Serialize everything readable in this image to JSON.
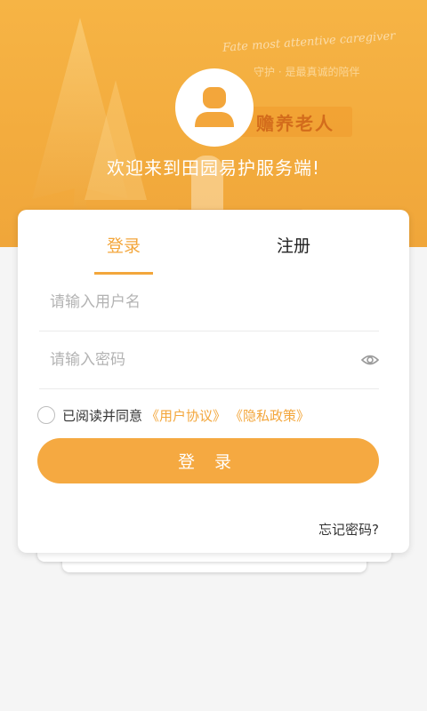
{
  "hero": {
    "deco_script": "Fate most attentive caregiver",
    "deco_line": "守护 · 是最真诚的陪伴",
    "deco_banner": "赡养老人",
    "welcome": "欢迎来到田园易护服务端!"
  },
  "tabs": [
    {
      "label": "登录",
      "active": true
    },
    {
      "label": "注册",
      "active": false
    }
  ],
  "form": {
    "username_placeholder": "请输入用户名",
    "username_value": "",
    "password_placeholder": "请输入密码",
    "password_value": "",
    "agree_text": "已阅读并同意",
    "user_agreement": "《用户协议》",
    "privacy_policy": "《隐私政策》",
    "agree_checked": false,
    "login_button": "登 录",
    "forgot_password": "忘记密码?"
  },
  "icons": {
    "avatar": "user-avatar-icon",
    "password_toggle": "eye-icon"
  },
  "colors": {
    "accent": "#f3a63b",
    "hero": "#f5b143",
    "button": "#f5a941"
  }
}
